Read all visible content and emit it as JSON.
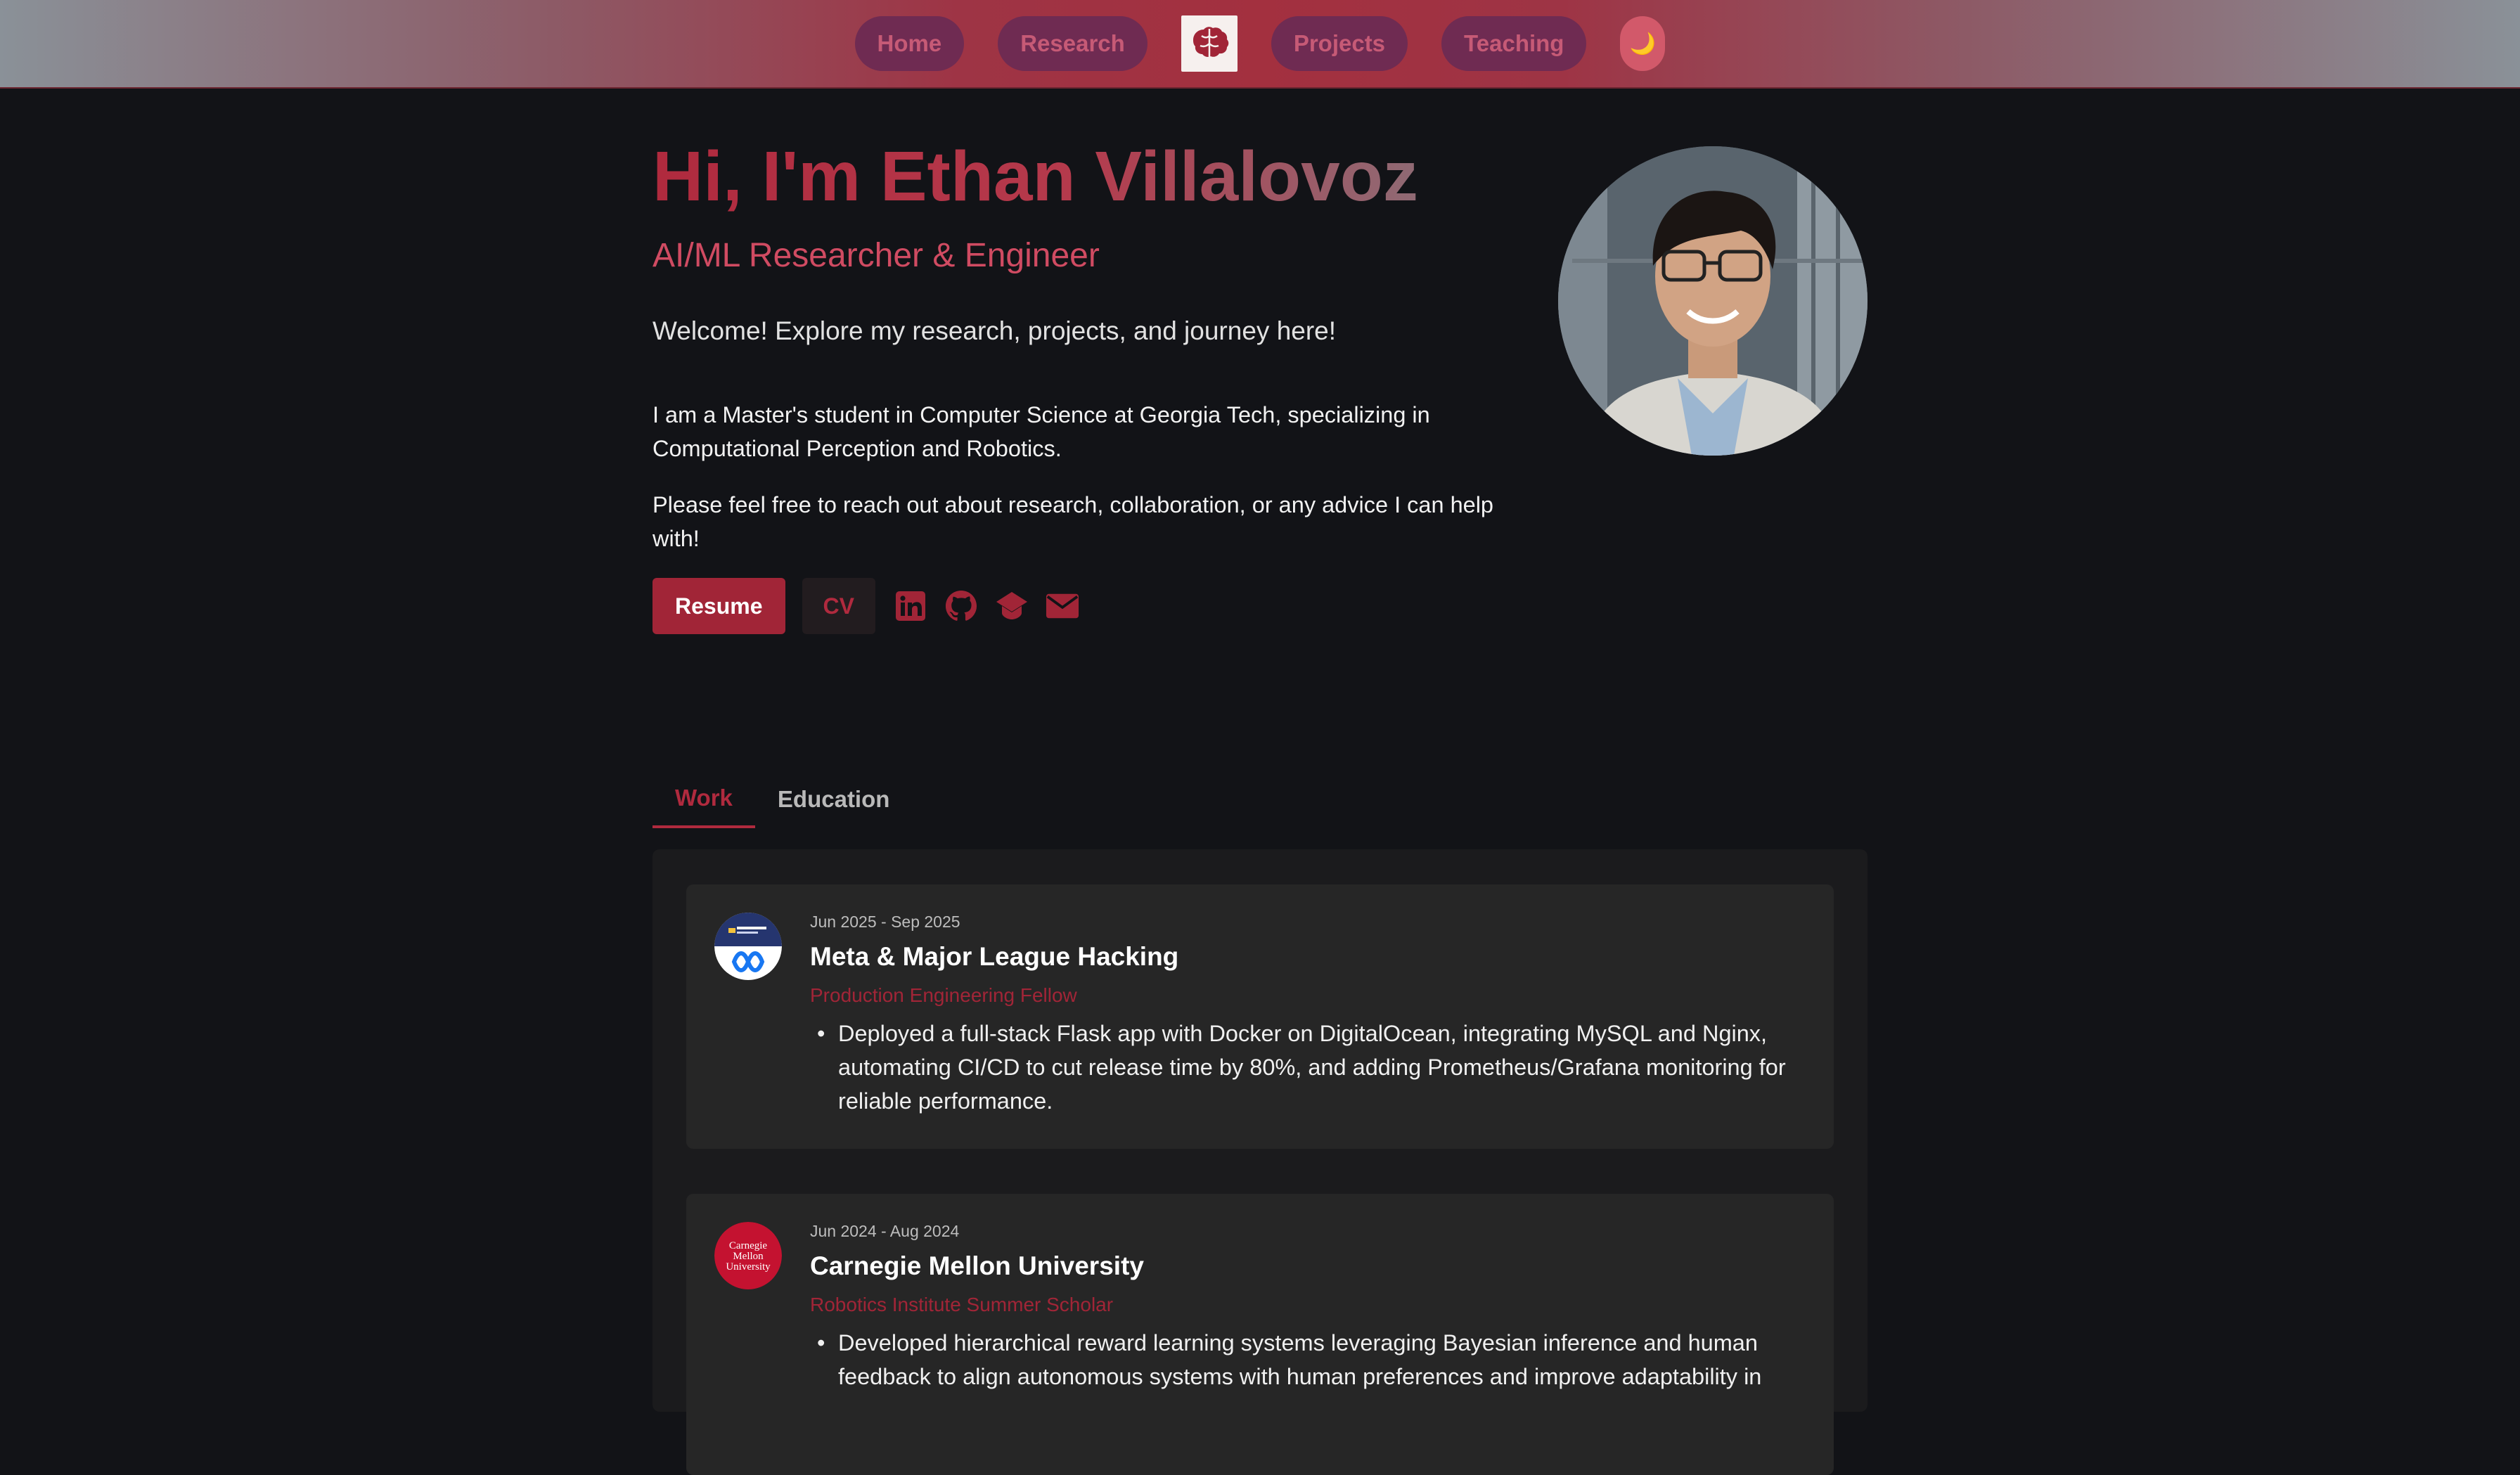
{
  "nav": {
    "items": [
      "Home",
      "Research",
      "Projects",
      "Teaching"
    ],
    "logo_icon": "brain-logo-icon",
    "theme_toggle_icon": "moon-icon",
    "colors": {
      "pill_bg": "#6f2b52",
      "pill_text": "#c65a76",
      "bar_accent": "#a3303f"
    }
  },
  "hero": {
    "title": "Hi, I'm Ethan Villalovoz",
    "subtitle": "AI/ML Researcher & Engineer",
    "welcome": "Welcome! Explore my research, projects, and journey here!",
    "bio": [
      "I am a Master's student in Computer Science at Georgia Tech, specializing in Computational Perception and Robotics.",
      "Please feel free to reach out about research, collaboration, or any advice I can help with!"
    ],
    "buttons": {
      "resume": "Resume",
      "cv": "CV"
    },
    "social_icons": [
      "linkedin-icon",
      "github-icon",
      "graduation-cap-icon",
      "email-icon"
    ],
    "accent_color": "#a12537"
  },
  "tabs": {
    "items": [
      "Work",
      "Education"
    ],
    "active": "Work"
  },
  "experience": [
    {
      "date": "Jun 2025 - Sep 2025",
      "org": "Meta & Major League Hacking",
      "role": "Production Engineering Fellow",
      "bullets": [
        "Deployed a full-stack Flask app with Docker on DigitalOcean, integrating MySQL and Nginx, automating CI/CD to cut release time by 80%, and adding Prometheus/Grafana monitoring for reliable performance."
      ]
    },
    {
      "date": "Jun 2024 - Aug 2024",
      "org": "Carnegie Mellon University",
      "role": "Robotics Institute Summer Scholar",
      "logo_text": [
        "Carnegie",
        "Mellon",
        "University"
      ],
      "bullets": [
        "Developed hierarchical reward learning systems leveraging Bayesian inference and human feedback to align autonomous systems with human preferences and improve adaptability in"
      ]
    }
  ]
}
